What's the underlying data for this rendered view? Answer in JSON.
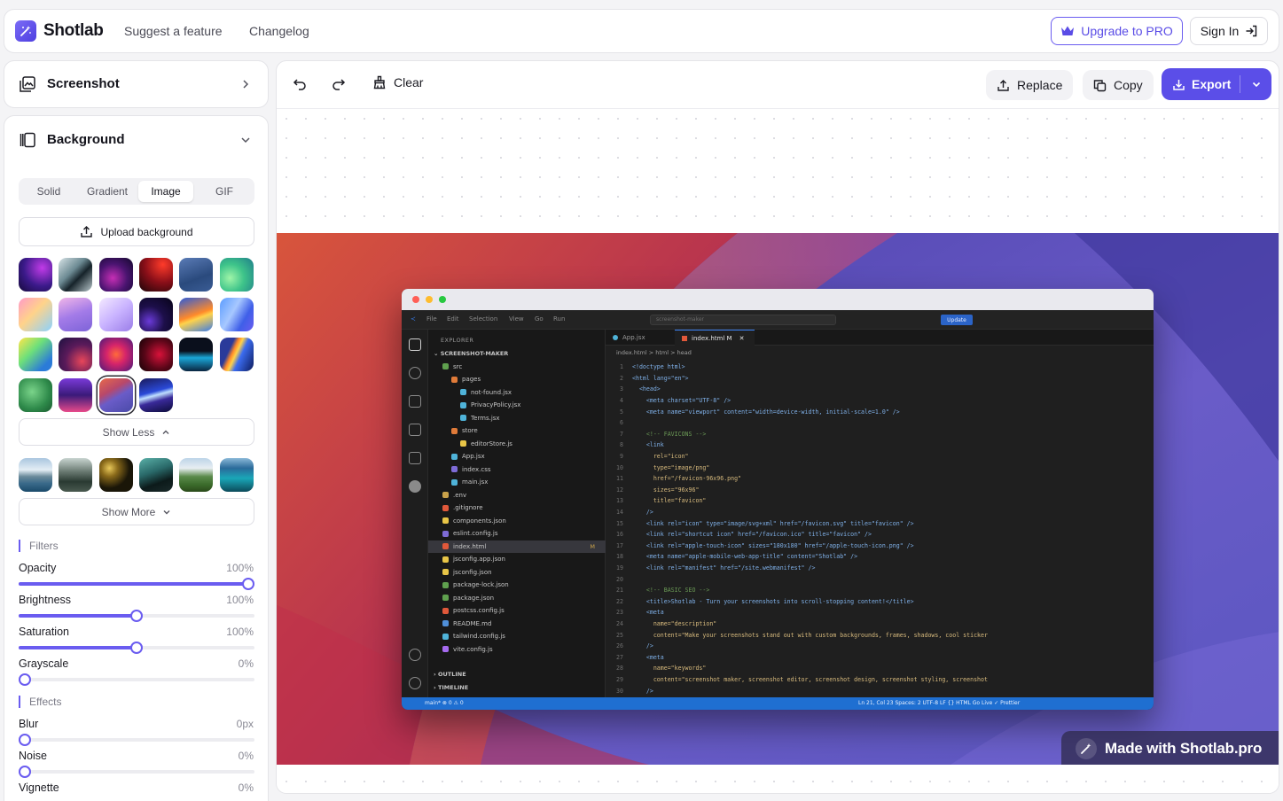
{
  "nav": {
    "brand": "Shotlab",
    "links": [
      "Suggest a feature",
      "Changelog"
    ],
    "upgrade": "Upgrade to PRO",
    "sign_in": "Sign In",
    "accent": "#5b4ee8"
  },
  "panel": {
    "screenshot_title": "Screenshot",
    "background_title": "Background",
    "tabs": [
      "Solid",
      "Gradient",
      "Image",
      "GIF"
    ],
    "active_tab": "Image",
    "upload": "Upload background",
    "show_less": "Show Less",
    "show_more": "Show More",
    "filters_label": "Filters",
    "effects_label": "Effects",
    "sliders": [
      {
        "name": "Opacity",
        "value": "100%",
        "level": 1.0
      },
      {
        "name": "Brightness",
        "value": "100%",
        "level": 0.5
      },
      {
        "name": "Saturation",
        "value": "100%",
        "level": 0.5
      },
      {
        "name": "Grayscale",
        "value": "0%",
        "level": 0.0
      }
    ],
    "effects": [
      {
        "name": "Blur",
        "value": "0px",
        "level": 0.0
      },
      {
        "name": "Noise",
        "value": "0%",
        "level": 0.0
      },
      {
        "name": "Vignette",
        "value": "0%",
        "level": 0.0
      }
    ]
  },
  "toolbar": {
    "clear": "Clear",
    "replace": "Replace",
    "copy": "Copy",
    "export": "Export"
  },
  "watermark": "Made with Shotlab.pro",
  "vscode": {
    "menu": [
      "File",
      "Edit",
      "Selection",
      "View",
      "Go",
      "Run"
    ],
    "search": "screenshot-maker",
    "update": "Update",
    "explorer": "EXPLORER",
    "project": "SCREENSHOT-MAKER",
    "tree": [
      {
        "name": "src",
        "indent": 1,
        "color": "#5fa04e"
      },
      {
        "name": "pages",
        "indent": 2,
        "color": "#e07b39"
      },
      {
        "name": "not-found.jsx",
        "indent": 3,
        "color": "#4fb3d9"
      },
      {
        "name": "PrivacyPolicy.jsx",
        "indent": 3,
        "color": "#4fb3d9"
      },
      {
        "name": "Terms.jsx",
        "indent": 3,
        "color": "#4fb3d9"
      },
      {
        "name": "store",
        "indent": 2,
        "color": "#e07b39"
      },
      {
        "name": "editorStore.js",
        "indent": 3,
        "color": "#e8c547"
      },
      {
        "name": "App.jsx",
        "indent": 2,
        "color": "#4fb3d9"
      },
      {
        "name": "index.css",
        "indent": 2,
        "color": "#7e6bd6"
      },
      {
        "name": "main.jsx",
        "indent": 2,
        "color": "#4fb3d9"
      },
      {
        "name": ".env",
        "indent": 1,
        "color": "#c9a24a"
      },
      {
        "name": ".gitignore",
        "indent": 1,
        "color": "#e0583a"
      },
      {
        "name": "components.json",
        "indent": 1,
        "color": "#e8c547"
      },
      {
        "name": "eslint.config.js",
        "indent": 1,
        "color": "#7e6bd6"
      },
      {
        "name": "index.html",
        "indent": 1,
        "color": "#e0583a",
        "badge": "M"
      },
      {
        "name": "jsconfig.app.json",
        "indent": 1,
        "color": "#e8c547"
      },
      {
        "name": "jsconfig.json",
        "indent": 1,
        "color": "#e8c547"
      },
      {
        "name": "package-lock.json",
        "indent": 1,
        "color": "#5fa04e"
      },
      {
        "name": "package.json",
        "indent": 1,
        "color": "#5fa04e"
      },
      {
        "name": "postcss.config.js",
        "indent": 1,
        "color": "#e0583a"
      },
      {
        "name": "README.md",
        "indent": 1,
        "color": "#4f8fd9"
      },
      {
        "name": "tailwind.config.js",
        "indent": 1,
        "color": "#4fb3d9"
      },
      {
        "name": "vite.config.js",
        "indent": 1,
        "color": "#a66bf0"
      }
    ],
    "outline": "OUTLINE",
    "timeline": "TIMELINE",
    "tabs": [
      "App.jsx",
      "index.html M"
    ],
    "crumbs": "index.html > html > head",
    "code": [
      "<!doctype html>",
      "<html lang=\"en\">",
      "  <head>",
      "    <meta charset=\"UTF-8\" />",
      "    <meta name=\"viewport\" content=\"width=device-width, initial-scale=1.0\" />",
      "",
      "    <!-- FAVICONS -->",
      "    <link",
      "      rel=\"icon\"",
      "      type=\"image/png\"",
      "      href=\"/favicon-96x96.png\"",
      "      sizes=\"96x96\"",
      "      title=\"favicon\"",
      "    />",
      "    <link rel=\"icon\" type=\"image/svg+xml\" href=\"/favicon.svg\" title=\"favicon\" />",
      "    <link rel=\"shortcut icon\" href=\"/favicon.ico\" title=\"favicon\" />",
      "    <link rel=\"apple-touch-icon\" sizes=\"180x180\" href=\"/apple-touch-icon.png\" />",
      "    <meta name=\"apple-mobile-web-app-title\" content=\"Shotlab\" />",
      "    <link rel=\"manifest\" href=\"/site.webmanifest\" />",
      "",
      "    <!-- BASIC SEO -->",
      "    <title>Shotlab - Turn your screenshots into scroll-stopping content!</title>",
      "    <meta",
      "      name=\"description\"",
      "      content=\"Make your screenshots stand out with custom backgrounds, frames, shadows, cool sticker",
      "    />",
      "    <meta",
      "      name=\"keywords\"",
      "      content=\"screenshot maker, screenshot editor, screenshot design, screenshot styling, screenshot",
      "    />"
    ],
    "status_left": "main*  ⊗ 0 ⚠ 0",
    "status_right": "Ln 21, Col 23   Spaces: 2   UTF-8   LF   {} HTML   Go Live   ✓ Prettier"
  }
}
